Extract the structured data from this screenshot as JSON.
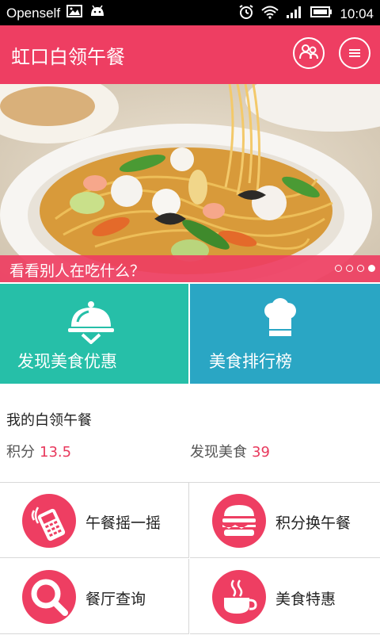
{
  "status_bar": {
    "carrier": "Openself",
    "time": "10:04"
  },
  "app_bar": {
    "title": "虹口白领午餐"
  },
  "banner": {
    "caption": "看看别人在吃什么？",
    "pages": 4,
    "active_page": 4
  },
  "tiles": [
    {
      "label": "发现美食优惠",
      "color": "#26bfa8"
    },
    {
      "label": "美食排行榜",
      "color": "#2aa6c4"
    }
  ],
  "mine": {
    "heading": "我的白领午餐",
    "points_label": "积分",
    "points_value": "13.5",
    "found_label": "发现美食",
    "found_value": "39"
  },
  "grid": {
    "items": [
      {
        "label": "午餐摇一摇",
        "icon": "phone-shake-icon"
      },
      {
        "label": "积分换午餐",
        "icon": "burger-icon"
      },
      {
        "label": "餐厅查询",
        "icon": "magnifier-icon"
      },
      {
        "label": "美食特惠",
        "icon": "coffee-cup-icon"
      }
    ]
  }
}
